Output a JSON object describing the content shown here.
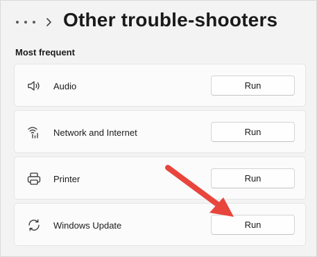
{
  "header": {
    "title": "Other trouble-shooters",
    "more_icon": "more-icon",
    "breadcrumb_icon": "chevron-right-icon"
  },
  "section": {
    "label": "Most frequent"
  },
  "items": [
    {
      "label": "Audio",
      "icon": "speaker-icon",
      "button": "Run"
    },
    {
      "label": "Network and Internet",
      "icon": "wifi-icon",
      "button": "Run"
    },
    {
      "label": "Printer",
      "icon": "printer-icon",
      "button": "Run"
    },
    {
      "label": "Windows Update",
      "icon": "refresh-icon",
      "button": "Run"
    }
  ],
  "annotation": {
    "arrow_color": "#e8453c"
  }
}
